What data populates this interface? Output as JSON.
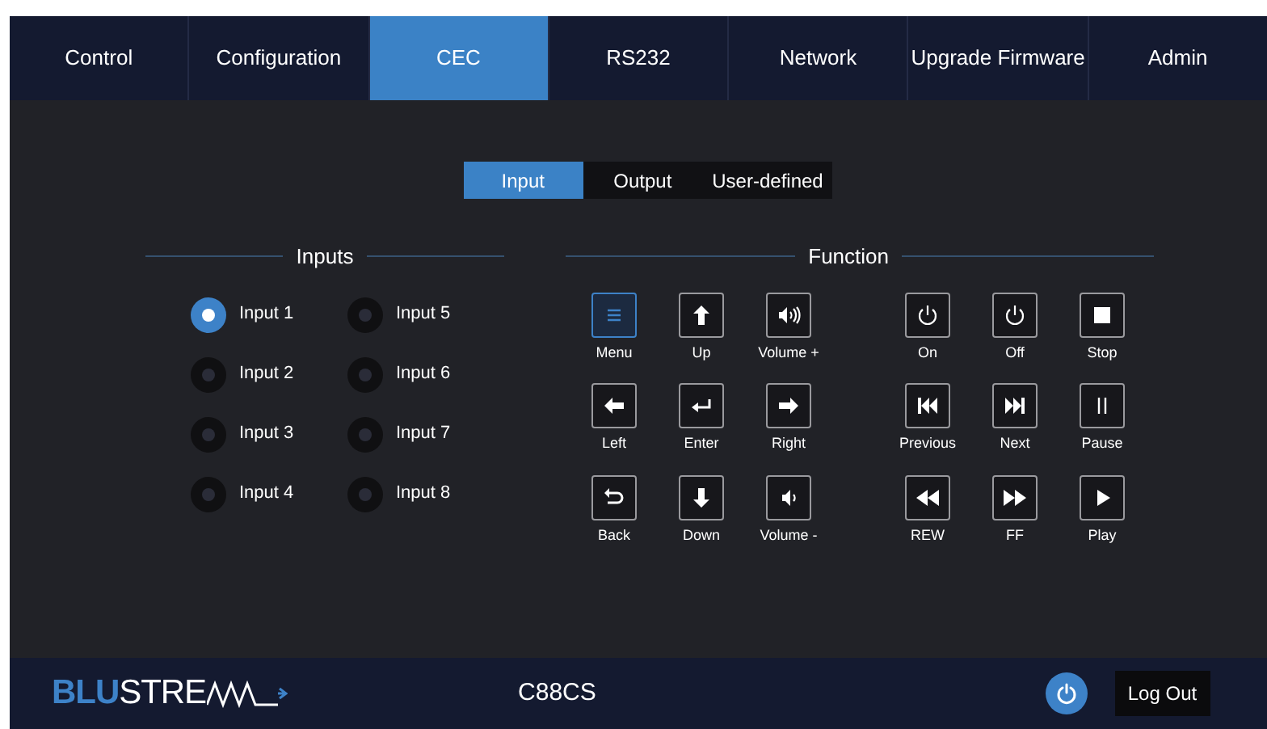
{
  "tabs": [
    {
      "label": "Control",
      "selected": false
    },
    {
      "label": "Configuration",
      "selected": false
    },
    {
      "label": "CEC",
      "selected": true
    },
    {
      "label": "RS232",
      "selected": false
    },
    {
      "label": "Network",
      "selected": false
    },
    {
      "label": "Upgrade Firmware",
      "selected": false
    },
    {
      "label": "Admin",
      "selected": false
    }
  ],
  "subtabs": [
    {
      "label": "Input",
      "selected": true
    },
    {
      "label": "Output",
      "selected": false
    },
    {
      "label": "User-defined",
      "selected": false
    }
  ],
  "inputs": {
    "title": "Inputs",
    "items": [
      {
        "label": "Input 1",
        "selected": true
      },
      {
        "label": "Input 2",
        "selected": false
      },
      {
        "label": "Input 3",
        "selected": false
      },
      {
        "label": "Input 4",
        "selected": false
      },
      {
        "label": "Input 5",
        "selected": false
      },
      {
        "label": "Input 6",
        "selected": false
      },
      {
        "label": "Input 7",
        "selected": false
      },
      {
        "label": "Input 8",
        "selected": false
      }
    ]
  },
  "function": {
    "title": "Function",
    "buttons": [
      {
        "label": "Menu",
        "kind": "menu",
        "selected": true
      },
      {
        "label": "Up",
        "kind": "up",
        "selected": false
      },
      {
        "label": "Volume +",
        "kind": "volup",
        "selected": false
      },
      {
        "label": "On",
        "kind": "power",
        "selected": false
      },
      {
        "label": "Off",
        "kind": "power",
        "selected": false
      },
      {
        "label": "Stop",
        "kind": "stop",
        "selected": false
      },
      {
        "label": "Left",
        "kind": "left",
        "selected": false
      },
      {
        "label": "Enter",
        "kind": "enter",
        "selected": false
      },
      {
        "label": "Right",
        "kind": "right",
        "selected": false
      },
      {
        "label": "Previous",
        "kind": "prev",
        "selected": false
      },
      {
        "label": "Next",
        "kind": "next",
        "selected": false
      },
      {
        "label": "Pause",
        "kind": "pause",
        "selected": false
      },
      {
        "label": "Back",
        "kind": "back",
        "selected": false
      },
      {
        "label": "Down",
        "kind": "down",
        "selected": false
      },
      {
        "label": "Volume -",
        "kind": "voldown",
        "selected": false
      },
      {
        "label": "REW",
        "kind": "rew",
        "selected": false
      },
      {
        "label": "FF",
        "kind": "ff",
        "selected": false
      },
      {
        "label": "Play",
        "kind": "play",
        "selected": false
      }
    ]
  },
  "footer": {
    "logo": {
      "accent": "BLU",
      "rest": "STRE"
    },
    "model": "C88CS",
    "logout": "Log Out"
  }
}
